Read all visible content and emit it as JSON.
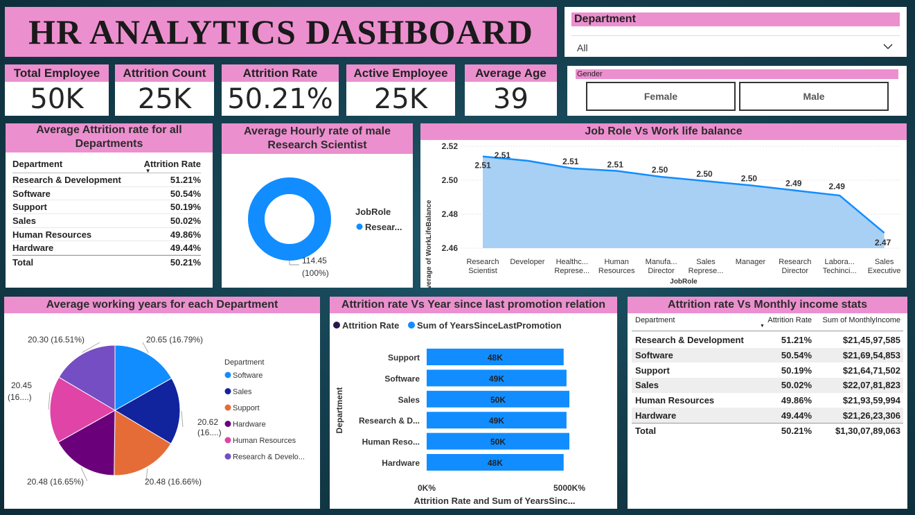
{
  "title": "HR ANALYTICS DASHBOARD",
  "department_slicer": {
    "label": "Department",
    "value": "All"
  },
  "kpis": [
    {
      "label": "Total Employee",
      "value": "50K"
    },
    {
      "label": "Attrition Count",
      "value": "25K"
    },
    {
      "label": "Attrition Rate",
      "value": "50.21%"
    },
    {
      "label": "Active Employee",
      "value": "25K"
    },
    {
      "label": "Average Age",
      "value": "39"
    }
  ],
  "gender_slicer": {
    "label": "Gender",
    "options": [
      "Female",
      "Male"
    ]
  },
  "attrition_table": {
    "title": "Average Attrition rate for all Departments",
    "columns": [
      "Department",
      "Attrition Rate"
    ],
    "rows": [
      [
        "Research & Development",
        "51.21%"
      ],
      [
        "Software",
        "50.54%"
      ],
      [
        "Support",
        "50.19%"
      ],
      [
        "Sales",
        "50.02%"
      ],
      [
        "Human Resources",
        "49.86%"
      ],
      [
        "Hardware",
        "49.44%"
      ]
    ],
    "total": [
      "Total",
      "50.21%"
    ]
  },
  "donut": {
    "title": "Average Hourly rate of male Research Scientist",
    "legend_title": "JobRole",
    "legend_item": "Resear...",
    "value_label": "114.45",
    "pct_label": "(100%)",
    "color": "#118dff"
  },
  "worklife_chart": {
    "title": "Job Role Vs Work life balance",
    "chart_data": {
      "type": "area",
      "ylabel": "Average of WorkLifeBalance",
      "xlabel": "JobRole",
      "ylim": [
        2.46,
        2.52
      ],
      "yticks": [
        "2.52",
        "2.50",
        "2.48",
        "2.46"
      ],
      "categories": [
        [
          "Research",
          "Scientist"
        ],
        [
          "Developer"
        ],
        [
          "Healthc...",
          "Represe..."
        ],
        [
          "Human",
          "Resources"
        ],
        [
          "Manufa...",
          "Director"
        ],
        [
          "Sales",
          "Represe..."
        ],
        [
          "Manager"
        ],
        [
          "Research",
          "Director"
        ],
        [
          "Labora...",
          "Techinci..."
        ],
        [
          "Sales",
          "Executive"
        ]
      ],
      "values": [
        2.514,
        2.5115,
        2.507,
        2.5055,
        2.502,
        2.4995,
        2.497,
        2.494,
        2.491,
        2.469
      ],
      "labels": [
        "2.51",
        "2.51",
        "2.51",
        "2.51",
        "2.50",
        "2.50",
        "2.50",
        "2.49",
        "2.49",
        "2.47"
      ],
      "color": "#118dff"
    }
  },
  "pie_chart": {
    "title": "Average working years for each Department",
    "legend_title": "Department",
    "chart_data": {
      "type": "pie",
      "slices": [
        {
          "name": "Software",
          "value": 20.65,
          "label": "20.65 (16.79%)",
          "color": "#118dff"
        },
        {
          "name": "Sales",
          "value": 20.62,
          "label": "20.62 (16....)",
          "color": "#12239e"
        },
        {
          "name": "Support",
          "value": 20.48,
          "label": "20.48 (16.66%)",
          "color": "#e66c37"
        },
        {
          "name": "Hardware",
          "value": 20.48,
          "label": "20.48 (16.65%)",
          "color": "#6b007b"
        },
        {
          "name": "Human Resources",
          "value": 20.45,
          "label": "20.45 (16....)",
          "color": "#e044a7"
        },
        {
          "name": "Research & Develo...",
          "value": 20.3,
          "label": "20.30 (16.51%)",
          "color": "#744ec2"
        }
      ]
    }
  },
  "promotion_chart": {
    "title": "Attrition rate Vs Year since last promotion relation",
    "legend": [
      {
        "name": "Attrition Rate",
        "color": "#2a1a4a"
      },
      {
        "name": "Sum of YearsSinceLastPromotion",
        "color": "#118dff"
      }
    ],
    "chart_data": {
      "type": "bar",
      "ylabel": "Department",
      "xlabel": "Attrition Rate and Sum of YearsSinc...",
      "xticks": [
        "0K%",
        "5000K%"
      ],
      "categories": [
        "Support",
        "Software",
        "Sales",
        "Research & D...",
        "Human Reso...",
        "Hardware"
      ],
      "values": [
        48,
        49,
        50,
        49,
        50,
        48
      ],
      "labels": [
        "48K",
        "49K",
        "50K",
        "49K",
        "50K",
        "48K"
      ],
      "color": "#118dff"
    }
  },
  "income_table": {
    "title": "Attrition rate Vs Monthly income stats",
    "columns": [
      "Department",
      "Attrition Rate",
      "Sum of MonthlyIncome"
    ],
    "rows": [
      [
        "Research & Development",
        "51.21%",
        "$21,45,97,585"
      ],
      [
        "Software",
        "50.54%",
        "$21,69,54,853"
      ],
      [
        "Support",
        "50.19%",
        "$21,64,71,502"
      ],
      [
        "Sales",
        "50.02%",
        "$22,07,81,823"
      ],
      [
        "Human Resources",
        "49.86%",
        "$21,93,59,994"
      ],
      [
        "Hardware",
        "49.44%",
        "$21,26,23,306"
      ]
    ],
    "total": [
      "Total",
      "50.21%",
      "$1,30,07,89,063"
    ]
  }
}
